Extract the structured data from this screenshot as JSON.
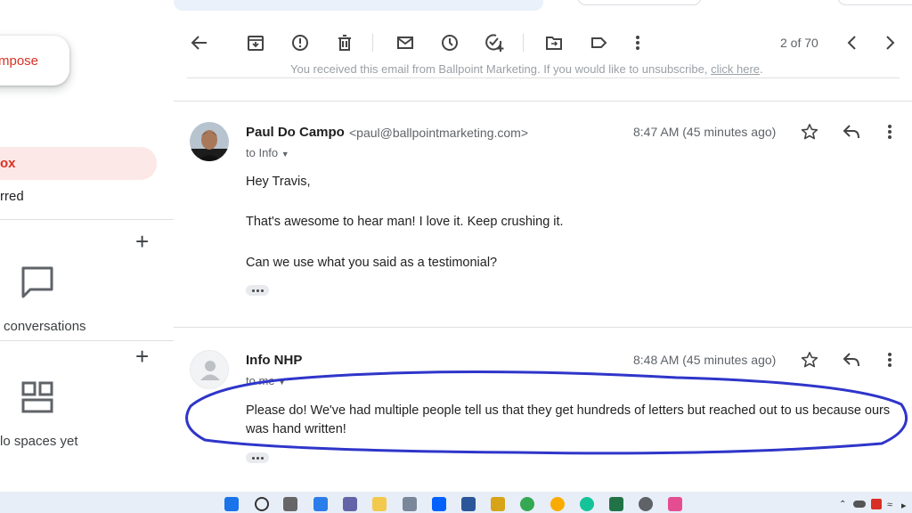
{
  "sidebar": {
    "compose_label": "mpose",
    "inbox_label": "ox",
    "starred_label": "rred",
    "conversations_caption": "conversations",
    "spaces_caption": "lo spaces yet"
  },
  "toolbar": {
    "pager": "2 of 70"
  },
  "notice": {
    "text": "You received this email from Ballpoint Marketing. If you would like to unsubscribe,",
    "link": "click here",
    "trail": "."
  },
  "messages": [
    {
      "sender": "Paul Do Campo",
      "email": "<paul@ballpointmarketing.com>",
      "to": "to Info",
      "time": "8:47 AM (45 minutes ago)",
      "lines": [
        "Hey Travis,",
        "That's awesome to hear man! I love it. Keep crushing it.",
        "Can we use what you said as a testimonial?"
      ]
    },
    {
      "sender": "Info NHP",
      "to": "to me",
      "time": "8:48 AM (45 minutes ago)",
      "lines": [
        "Please do! We've had multiple people tell us that they get hundreds of letters but reached out to us because ours",
        "was hand written!"
      ]
    }
  ],
  "colors": {
    "accent": "#d93025",
    "inbox_bg": "#fce8e6",
    "annotation": "#2f35c9"
  }
}
